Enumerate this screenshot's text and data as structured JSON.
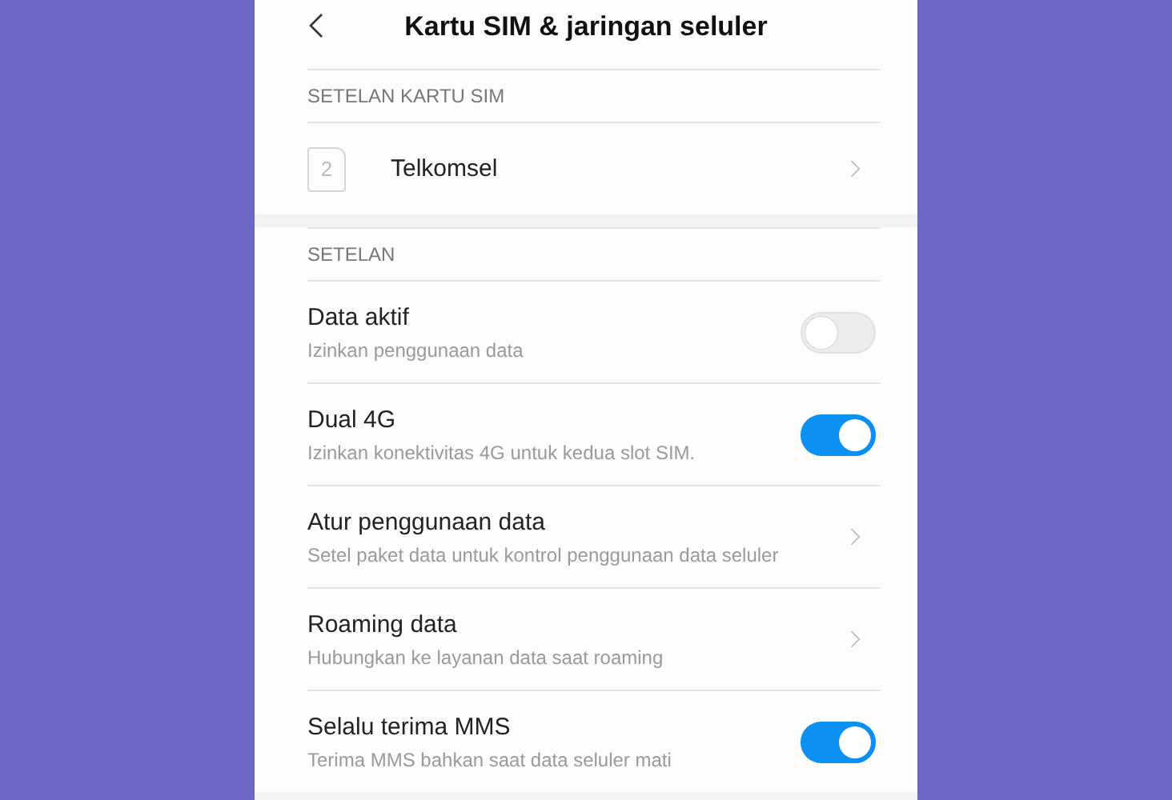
{
  "header": {
    "title": "Kartu SIM & jaringan seluler"
  },
  "sections": [
    {
      "label": "SETELAN KARTU SIM",
      "items": [
        {
          "kind": "sim",
          "slot": "2",
          "title": "Telkomsel"
        }
      ]
    },
    {
      "label": "SETELAN",
      "items": [
        {
          "kind": "toggle",
          "title": "Data aktif",
          "subtitle": "Izinkan penggunaan data",
          "on": false
        },
        {
          "kind": "toggle",
          "title": "Dual 4G",
          "subtitle": "Izinkan konektivitas 4G untuk kedua slot SIM.",
          "on": true
        },
        {
          "kind": "link",
          "title": "Atur penggunaan data",
          "subtitle": "Setel paket data untuk kontrol penggunaan data seluler"
        },
        {
          "kind": "link",
          "title": "Roaming data",
          "subtitle": "Hubungkan ke layanan data saat roaming"
        },
        {
          "kind": "toggle",
          "title": "Selalu terima MMS",
          "subtitle": "Terima MMS bahkan saat data seluler mati",
          "on": true
        }
      ]
    }
  ]
}
